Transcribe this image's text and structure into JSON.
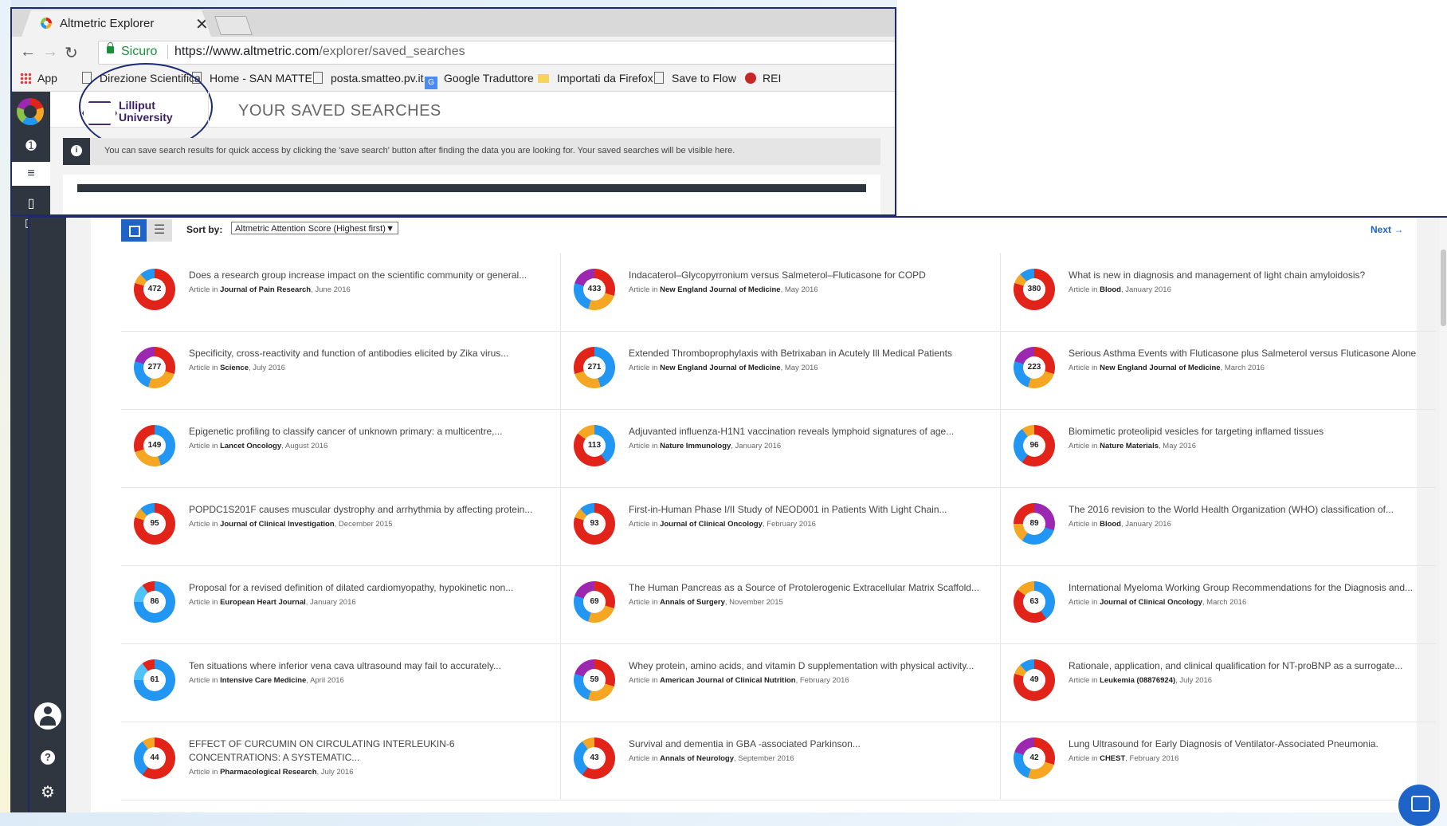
{
  "browser": {
    "tab_title": "Altmetric Explorer",
    "tab_close": "✕",
    "secure_label": "Sicuro",
    "url_host": "https://www.altmetric.com",
    "url_path": "/explorer/saved_searches",
    "bookmarks": [
      "App",
      "Direzione Scientifica",
      "Home - SAN MATTE",
      "posta.smatteo.pv.it",
      "Google Traduttore",
      "Importati da Firefox",
      "Save to Flow",
      "REI"
    ]
  },
  "top_page": {
    "org_name_line1": "Lilliput",
    "org_name_line2": "University",
    "title": "YOUR SAVED SEARCHES",
    "info_text": "You can save search results for quick access by clicking the 'save search' button after finding the data you are looking for. Your saved searches will be visible here."
  },
  "results": {
    "sort_label": "Sort by:",
    "sort_value": "Altmetric Attention Score (Highest first)",
    "next_label": "Next →",
    "article_prefix": "Article in",
    "rows": [
      [
        {
          "score": "472",
          "title": "Does a research group increase impact on the scientific community or general...",
          "journal": "Journal of Pain Research",
          "date": ", June 2016",
          "ring": "red"
        },
        {
          "score": "433",
          "title": "Indacaterol–Glycopyrronium versus Salmeterol–Fluticasone for COPD",
          "journal": "New England Journal of Medicine",
          "date": ", May 2016",
          "ring": "mixed"
        },
        {
          "score": "380",
          "title": "What is new in diagnosis and management of light chain amyloidosis?",
          "journal": "Blood",
          "date": ", January 2016",
          "ring": "red"
        }
      ],
      [
        {
          "score": "277",
          "title": "Specificity, cross-reactivity and function of antibodies elicited by Zika virus...",
          "journal": "Science",
          "date": ", July 2016",
          "ring": "mixed"
        },
        {
          "score": "271",
          "title": "Extended Thromboprophylaxis with Betrixaban in Acutely Ill Medical Patients",
          "journal": "New England Journal of Medicine",
          "date": ", May 2016",
          "ring": "bluey"
        },
        {
          "score": "223",
          "title": "Serious Asthma Events with Fluticasone plus Salmeterol versus Fluticasone Alone",
          "journal": "New England Journal of Medicine",
          "date": ", March 2016",
          "ring": "mixed"
        }
      ],
      [
        {
          "score": "149",
          "title": "Epigenetic profiling to classify cancer of unknown primary: a multicentre,...",
          "journal": "Lancet Oncology",
          "date": ", August 2016",
          "ring": "bluey"
        },
        {
          "score": "113",
          "title": "Adjuvanted influenza-H1N1 vaccination reveals lymphoid signatures of age...",
          "journal": "Nature Immunology",
          "date": ", January 2016",
          "ring": "bluered"
        },
        {
          "score": "96",
          "title": "Biomimetic proteolipid vesicles for targeting inflamed tissues",
          "journal": "Nature Materials",
          "date": ", May 2016",
          "ring": "redblue"
        }
      ],
      [
        {
          "score": "95",
          "title": "POPDC1S201F causes muscular dystrophy and arrhythmia by affecting protein...",
          "journal": "Journal of Clinical Investigation",
          "date": ", December 2015",
          "ring": "red"
        },
        {
          "score": "93",
          "title": "First-in-Human Phase I/II Study of NEOD001 in Patients With Light Chain...",
          "journal": "Journal of Clinical Oncology",
          "date": ", February 2016",
          "ring": "red"
        },
        {
          "score": "89",
          "title": "The 2016 revision to the World Health Organization (WHO) classification of...",
          "journal": "Blood",
          "date": ", January 2016",
          "ring": "purple"
        }
      ],
      [
        {
          "score": "86",
          "title": "Proposal for a revised definition of dilated cardiomyopathy, hypokinetic non...",
          "journal": "European Heart Journal",
          "date": ", January 2016",
          "ring": "blue"
        },
        {
          "score": "69",
          "title": "The Human Pancreas as a Source of Protolerogenic Extracellular Matrix Scaffold...",
          "journal": "Annals of Surgery",
          "date": ", November 2015",
          "ring": "mixed"
        },
        {
          "score": "63",
          "title": "International Myeloma Working Group Recommendations for the Diagnosis and...",
          "journal": "Journal of Clinical Oncology",
          "date": ", March 2016",
          "ring": "bluered"
        }
      ],
      [
        {
          "score": "61",
          "title": "Ten situations where inferior vena cava ultrasound may fail to accurately...",
          "journal": "Intensive Care Medicine",
          "date": ", April 2016",
          "ring": "blue"
        },
        {
          "score": "59",
          "title": "Whey protein, amino acids, and vitamin D supplementation with physical activity...",
          "journal": "American Journal of Clinical Nutrition",
          "date": ", February 2016",
          "ring": "mixed"
        },
        {
          "score": "49",
          "title": "Rationale, application, and clinical qualification for NT-proBNP as a surrogate...",
          "journal": "Leukemia (08876924)",
          "date": ", July 2016",
          "ring": "red"
        }
      ],
      [
        {
          "score": "44",
          "title": "EFFECT OF CURCUMIN ON CIRCULATING INTERLEUKIN-6 CONCENTRATIONS: A SYSTEMATIC...",
          "journal": "Pharmacological Research",
          "date": ", July 2016",
          "ring": "redblue",
          "two_line": true
        },
        {
          "score": "43",
          "title": "Survival and dementia in GBA -associated Parkinson...",
          "journal": "Annals of Neurology",
          "date": ", September 2016",
          "ring": "redblue"
        },
        {
          "score": "42",
          "title": "Lung Ultrasound for Early Diagnosis of Ventilator-Associated Pneumonia.",
          "journal": "CHEST",
          "date": ", February 2016",
          "ring": "mixed"
        }
      ]
    ]
  },
  "ring_gradients": {
    "red": "conic-gradient(#e2231a 0 80%,#f5a623 0 88%,#2196f3 0 100%)",
    "mixed": "conic-gradient(#e2231a 0 30%,#f5a623 0 55%,#2196f3 0 80%,#9c27b0 0 100%)",
    "bluey": "conic-gradient(#2196f3 0 45%,#f5a623 0 70%,#e2231a 0 100%)",
    "bluered": "conic-gradient(#2196f3 0 40%,#e2231a 0 85%,#f5a623 0 100%)",
    "redblue": "conic-gradient(#e2231a 0 60%,#2196f3 0 90%,#f5a623 0 100%)",
    "purple": "conic-gradient(#9c27b0 0 30%,#2196f3 0 60%,#f5a623 0 75%,#e2231a 0 100%)",
    "blue": "conic-gradient(#2196f3 0 75%,#4fc3f7 0 90%,#e2231a 0 100%)"
  }
}
